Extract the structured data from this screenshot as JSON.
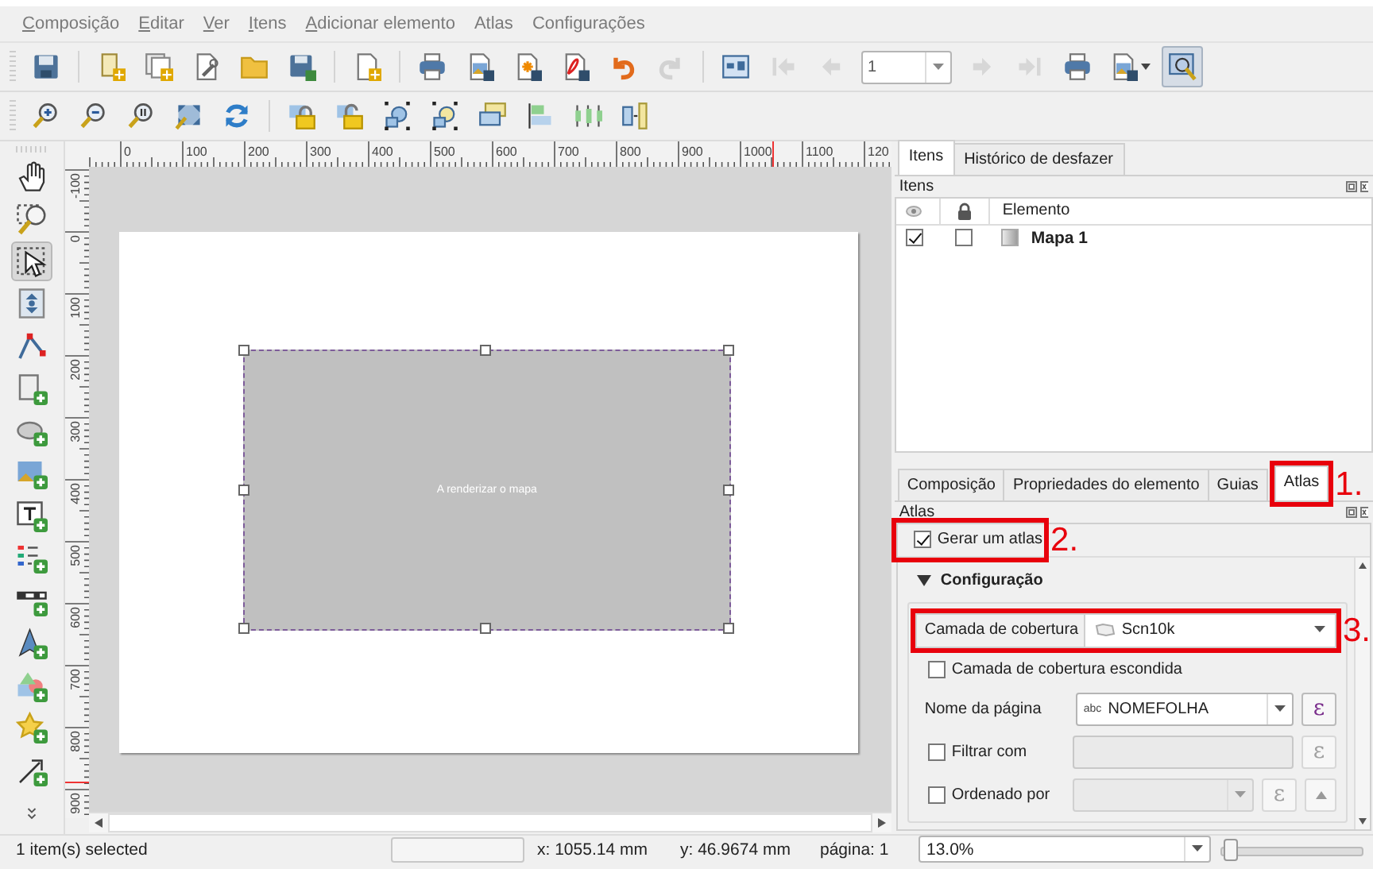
{
  "menu": [
    {
      "label": "Composição",
      "mnemonic": true
    },
    {
      "label": "Editar",
      "mnemonic": true
    },
    {
      "label": "Ver",
      "mnemonic": true
    },
    {
      "label": "Itens",
      "mnemonic": true
    },
    {
      "label": "Adicionar elemento",
      "mnemonic": true
    },
    {
      "label": "Atlas",
      "mnemonic": false
    },
    {
      "label": "Configurações",
      "mnemonic": false
    }
  ],
  "toolbar_1": [
    {
      "disabled": false,
      "pressed": false
    },
    {
      "disabled": false,
      "pressed": false
    },
    {
      "disabled": false,
      "pressed": false
    },
    {
      "disabled": false,
      "pressed": false
    },
    {
      "disabled": false,
      "pressed": false
    },
    {
      "disabled": false,
      "pressed": false
    },
    {
      "disabled": false,
      "pressed": false
    },
    {
      "disabled": false,
      "pressed": false
    },
    {
      "disabled": false,
      "pressed": false
    },
    {
      "disabled": false,
      "pressed": false
    },
    {
      "disabled": false,
      "pressed": false
    },
    {
      "disabled": false,
      "pressed": false
    },
    {
      "disabled": true,
      "pressed": false
    },
    {
      "disabled": false,
      "pressed": false
    },
    {
      "disabled": true,
      "pressed": false
    },
    {
      "disabled": true,
      "pressed": false
    },
    {
      "disabled": true,
      "pressed": false
    },
    {
      "disabled": true,
      "pressed": false
    },
    {
      "disabled": false,
      "pressed": false
    },
    {
      "disabled": false,
      "pressed": false
    },
    {
      "disabled": false,
      "pressed": true
    }
  ],
  "page_field": {
    "value": "1"
  },
  "toolbar_2": [
    {
      "disabled": false
    },
    {
      "disabled": false
    },
    {
      "disabled": false
    },
    {
      "disabled": false
    },
    {
      "disabled": false
    },
    {
      "disabled": false
    },
    {
      "disabled": false
    },
    {
      "disabled": false
    },
    {
      "disabled": false
    },
    {
      "disabled": false
    },
    {
      "disabled": false
    },
    {
      "disabled": false
    },
    {
      "disabled": false
    }
  ],
  "tools": [
    {
      "selected": false
    },
    {
      "selected": false
    },
    {
      "selected": true
    },
    {
      "selected": false
    },
    {
      "selected": false
    },
    {
      "selected": false
    },
    {
      "selected": false
    },
    {
      "selected": false
    },
    {
      "selected": false
    },
    {
      "selected": false
    },
    {
      "selected": false
    },
    {
      "selected": false
    },
    {
      "selected": false
    },
    {
      "selected": false
    },
    {
      "selected": false
    },
    {
      "selected": false
    }
  ],
  "ruler_h": [
    "0",
    "100",
    "200",
    "300",
    "400",
    "500",
    "600",
    "700",
    "800",
    "900",
    "1000",
    "1100",
    "120"
  ],
  "ruler_v": [
    "-100",
    "0",
    "100",
    "200",
    "300",
    "400",
    "500",
    "600",
    "700",
    "800",
    "900"
  ],
  "map_item": {
    "text": "A renderizar o mapa"
  },
  "items_panel": {
    "tabs": [
      {
        "label": "Itens",
        "selected": true
      },
      {
        "label": "Histórico de desfazer",
        "selected": false
      }
    ],
    "title": "Itens",
    "columns": [
      "Elemento"
    ],
    "rows": [
      {
        "visible": true,
        "locked": false,
        "name": "Mapa 1"
      }
    ]
  },
  "properties_panel": {
    "tabs": [
      {
        "label": "Composição",
        "selected": false
      },
      {
        "label": "Propriedades do elemento",
        "selected": false
      },
      {
        "label": "Guias",
        "selected": false
      },
      {
        "label": "Atlas",
        "selected": true,
        "annotation": "1."
      }
    ],
    "title": "Atlas",
    "generate_atlas": {
      "label": "Gerar um atlas",
      "checked": true,
      "annotation": "2."
    },
    "group": {
      "title": "Configuração",
      "expanded": true
    },
    "coverage_layer": {
      "label": "Camada de cobertura",
      "value": "Scn10k",
      "annotation": "3."
    },
    "hidden_coverage": {
      "label": "Camada de cobertura escondida",
      "checked": false
    },
    "page_name": {
      "label": "Nome da página",
      "type_tag": "abc",
      "value": "NOMEFOLHA",
      "expression": "ε"
    },
    "filter": {
      "label": "Filtrar com",
      "checked": false,
      "expression": "ε"
    },
    "sort": {
      "label": "Ordenado por",
      "checked": false,
      "expression": "ε"
    }
  },
  "status_bar": {
    "message": "1 item(s) selected",
    "progress": {
      "level": 0
    },
    "x": "x: 1055.14 mm",
    "y": "y: 46.9674 mm",
    "page": "página: 1",
    "zoom": "13.0%",
    "zoom_slider": {
      "level": 0.02
    }
  }
}
